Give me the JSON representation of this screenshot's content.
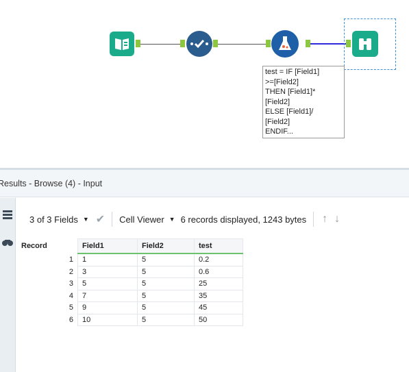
{
  "workflow": {
    "annotation_lines": [
      "test = IF [Field1]",
      ">=[Field2]",
      "THEN [Field1]*",
      "[Field2]",
      "ELSE [Field1]/",
      "[Field2]",
      "ENDIF..."
    ],
    "tools": [
      "input-tool",
      "select-tool",
      "formula-tool",
      "browse-tool"
    ],
    "colors": {
      "input": "#1aab8a",
      "select": "#2a5d8e",
      "formula": "#1f5fa8",
      "browse": "#1aab8a",
      "anchor": "#8dc63f"
    }
  },
  "results": {
    "title": "Results - Browse (4) - Input",
    "fields_label": "3 of 3 Fields",
    "cell_viewer_label": "Cell Viewer",
    "records_info": "6 records displayed, 1243 bytes",
    "columns": [
      "Record",
      "Field1",
      "Field2",
      "test"
    ],
    "rows": [
      [
        "1",
        "1",
        "5",
        "0.2"
      ],
      [
        "2",
        "3",
        "5",
        "0.6"
      ],
      [
        "3",
        "5",
        "5",
        "25"
      ],
      [
        "4",
        "7",
        "5",
        "35"
      ],
      [
        "5",
        "9",
        "5",
        "45"
      ],
      [
        "6",
        "10",
        "5",
        "50"
      ]
    ]
  }
}
